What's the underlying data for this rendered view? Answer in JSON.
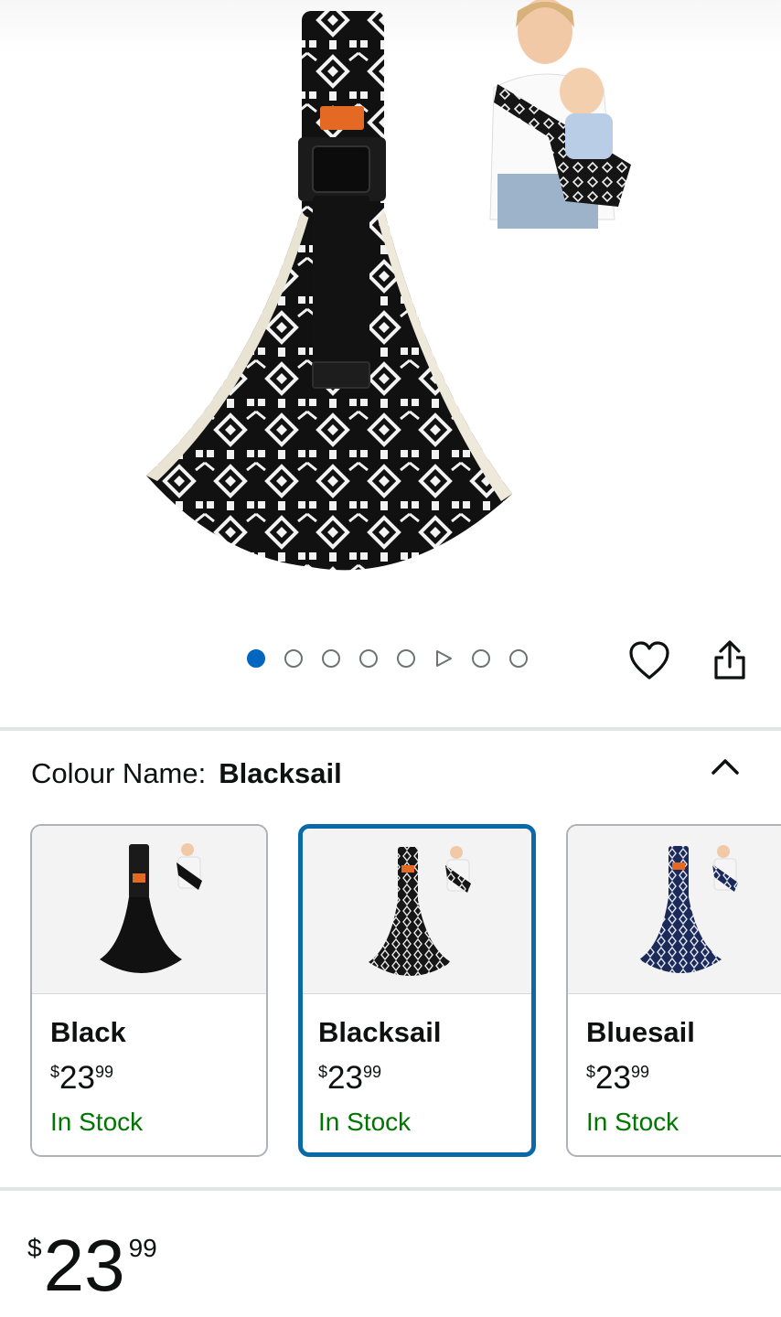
{
  "hero": {
    "main_image": "baby sling carrier product photo (Blacksail)",
    "inset_image": "woman wearing sling with baby"
  },
  "carousel": {
    "dots": [
      "image",
      "image",
      "image",
      "image",
      "image",
      "video",
      "image",
      "image"
    ],
    "active_index": 0,
    "accent_color": "#0066c0"
  },
  "actions": {
    "wishlist_icon": "heart-icon",
    "share_icon": "share-icon"
  },
  "colour": {
    "label": "Colour Name:",
    "selected": "Blacksail",
    "collapse_icon": "chevron-up-icon"
  },
  "swatches": [
    {
      "name": "Black",
      "currency": "$",
      "whole": "23",
      "fraction": "99",
      "stock": "In Stock",
      "selected": false,
      "color": "#111111"
    },
    {
      "name": "Blacksail",
      "currency": "$",
      "whole": "23",
      "fraction": "99",
      "stock": "In Stock",
      "selected": true,
      "color": "#222222"
    },
    {
      "name": "Bluesail",
      "currency": "$",
      "whole": "23",
      "fraction": "99",
      "stock": "In Stock",
      "selected": false,
      "color": "#1c2a5a"
    }
  ],
  "price": {
    "currency": "$",
    "whole": "23",
    "fraction": "99"
  },
  "colors": {
    "stock_green": "#007600",
    "selected_border": "#0a6aa8"
  }
}
